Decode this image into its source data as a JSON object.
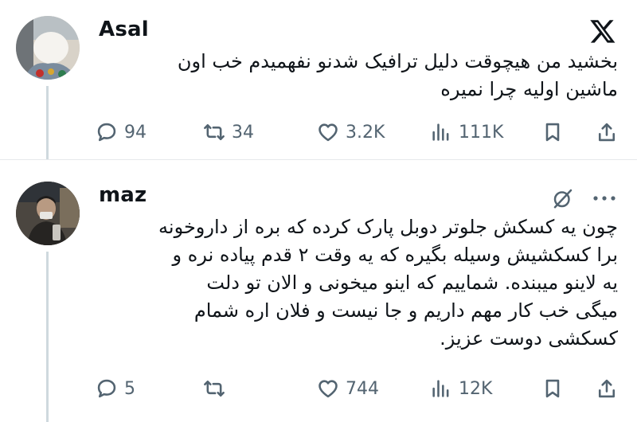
{
  "tweets": [
    {
      "author": "Asal",
      "text_lines": [
        "بخشید من هیچوقت دلیل ترافیک شدنو نفهمیدم خب اون",
        "ماشین اولیه چرا نمیره"
      ],
      "stats": {
        "replies": "94",
        "retweets": "34",
        "likes": "3.2K",
        "views": "111K"
      }
    },
    {
      "author": "maz",
      "text_lines": [
        "چون یه کسکش جلوتر دوبل پارک کرده که بره از داروخونه",
        "برا کسکشیش وسیله بگیره که یه وقت ۲ قدم پیاده نره و",
        "یه لاینو میبنده. شماییم که اینو میخونی و الان تو دلت",
        "میگی خب کار مهم داریم و جا نیست و فلان اره شمام",
        "کسکشی دوست عزیز."
      ],
      "stats": {
        "replies": "5",
        "retweets": "",
        "likes": "744",
        "views": "12K"
      }
    }
  ],
  "icons": [
    "x-logo-icon",
    "grok-icon",
    "more-icon",
    "reply-icon",
    "retweet-icon",
    "like-icon",
    "views-icon",
    "bookmark-icon",
    "share-icon"
  ]
}
